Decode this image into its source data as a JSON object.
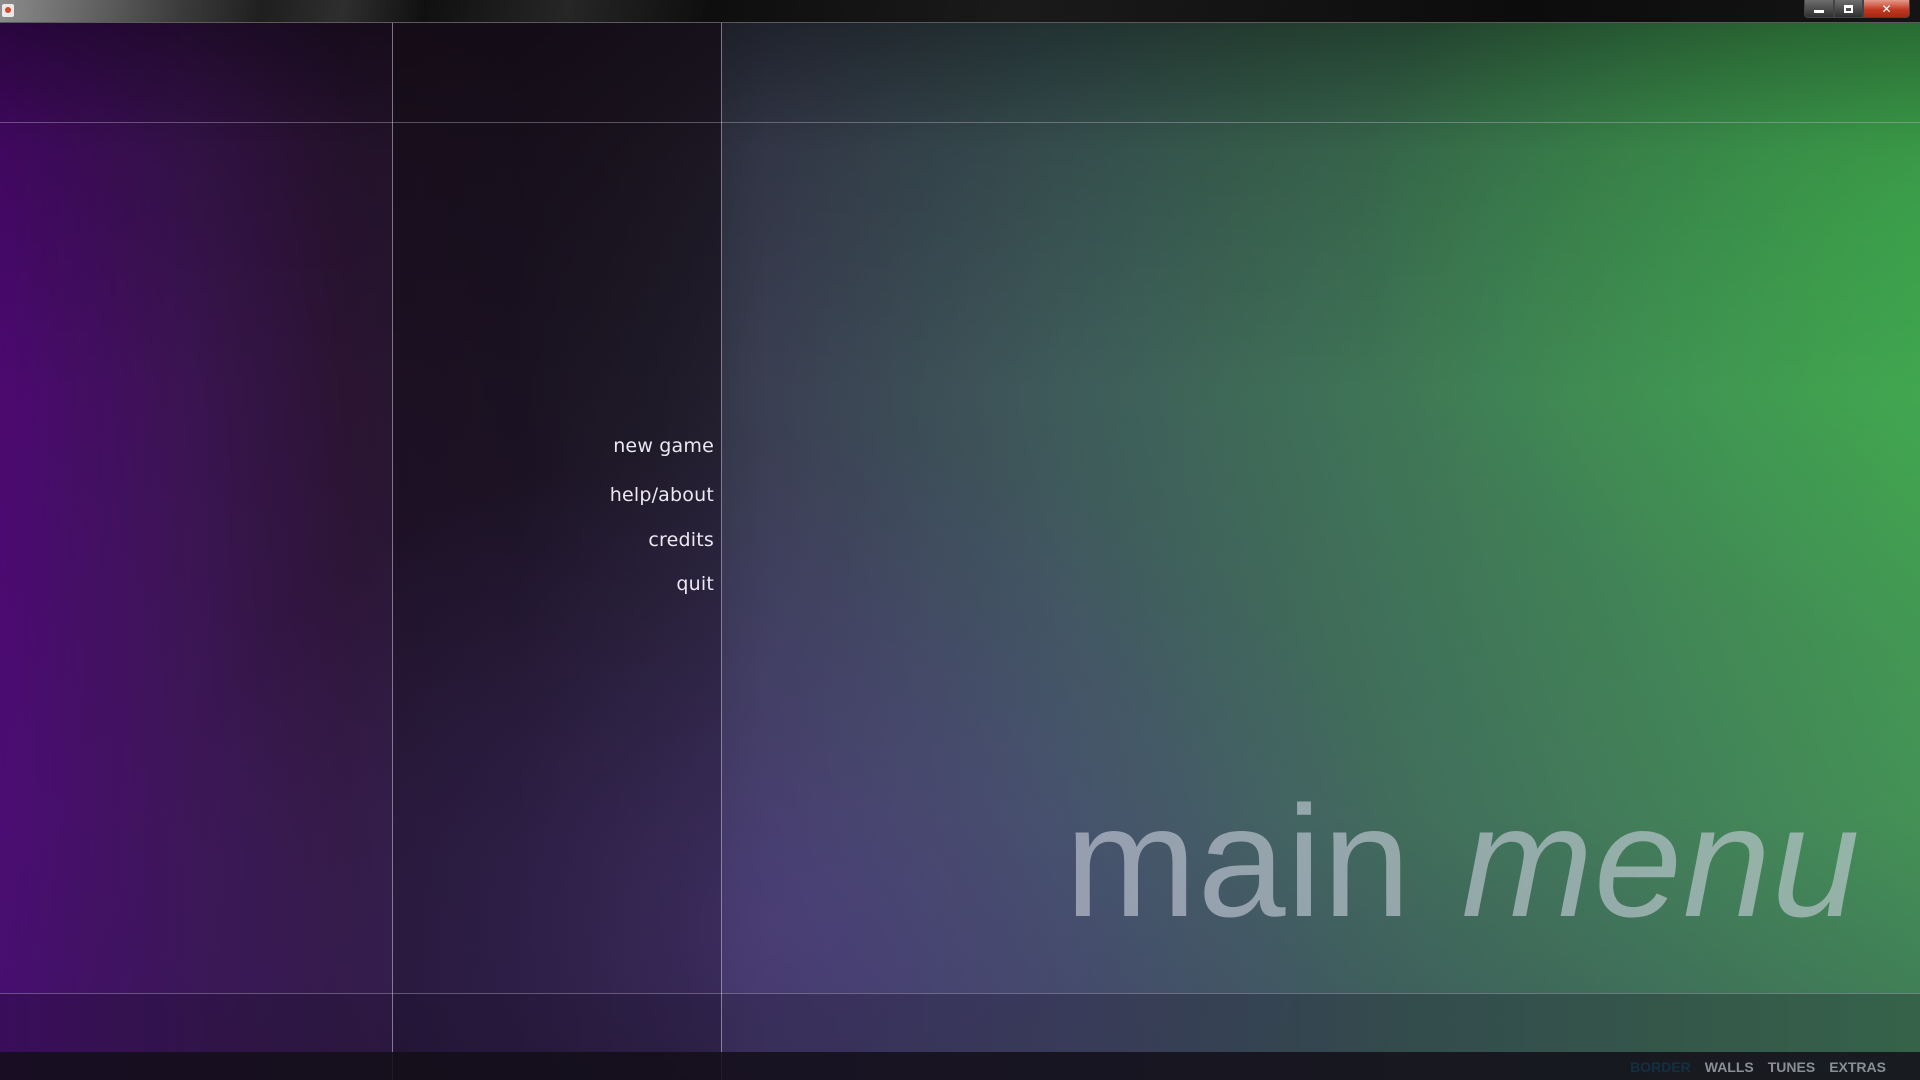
{
  "window": {
    "min_icon": "minimize-icon",
    "max_icon": "maximize-icon",
    "close_label": "✕",
    "app_icon": "java-app-icon"
  },
  "menu": {
    "items": [
      "new game",
      "help/about",
      "credits",
      "quit"
    ]
  },
  "title": {
    "part1": "main",
    "part2": "menu"
  },
  "tabs": {
    "items": [
      "BORDER",
      "WALLS",
      "TUNES",
      "EXTRAS"
    ],
    "active": "BORDER"
  },
  "colors": {
    "left_purple": "#4b0970",
    "right_green": "#42a04f",
    "menu_text": "#ece8f2",
    "title_text": "#c8ceda",
    "tab_active": "#123044",
    "tab_normal": "#8a8e96",
    "close_button": "#c23a22"
  }
}
